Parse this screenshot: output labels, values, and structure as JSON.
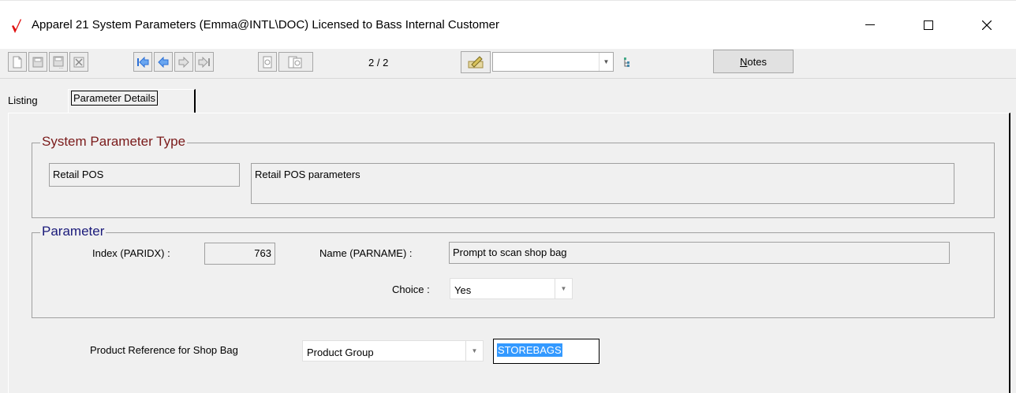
{
  "window": {
    "title": "Apparel 21 System Parameters (Emma@INTL\\DOC) Licensed to Bass Internal Customer",
    "minimize_glyph": "—",
    "maximize_glyph": "☐",
    "close_glyph": "✕"
  },
  "toolbar": {
    "record_position": "2 / 2",
    "notes_label": "Notes",
    "notes_hotkey": "N",
    "notes_rest": "otes",
    "filter_value": "",
    "icons": [
      "new-icon",
      "save-icon",
      "save-as-icon",
      "delete-icon",
      "first-record-icon",
      "previous-record-icon",
      "next-record-icon",
      "last-record-icon",
      "preview-icon",
      "print-preview-icon",
      "edit-pencil-icon",
      "tree-view-icon"
    ]
  },
  "tabs": [
    {
      "label": "Listing"
    },
    {
      "label": "Parameter Details"
    }
  ],
  "system_parameter_type": {
    "legend": "System Parameter Type",
    "code": "Retail POS",
    "description": "Retail POS parameters"
  },
  "parameter": {
    "legend": "Parameter",
    "index_label": "Index (PARIDX) :",
    "index_value": "763",
    "name_label": "Name (PARNAME) :",
    "name_value": "Prompt to scan shop bag",
    "choice_label": "Choice :",
    "choice_value": "Yes"
  },
  "product_reference": {
    "label": "Product Reference for Shop Bag",
    "type_value": "Product Group",
    "code_value": "STOREBAGS"
  },
  "colors": {
    "legend_type": "#7a1a1a",
    "legend_parameter": "#1a1a7a",
    "selection": "#3399ff",
    "nav_arrow": "#2b6fd6",
    "app_icon": "#e01010"
  }
}
